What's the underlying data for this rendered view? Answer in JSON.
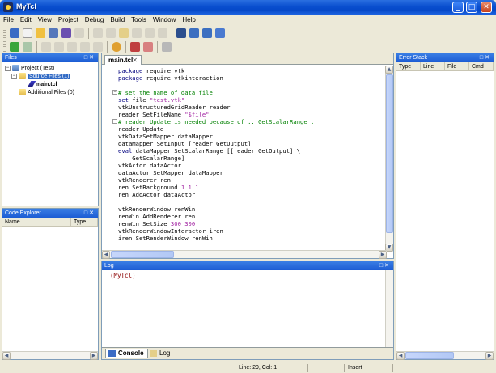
{
  "window": {
    "title": "MyTcl"
  },
  "menu": [
    "File",
    "Edit",
    "View",
    "Project",
    "Debug",
    "Build",
    "Tools",
    "Window",
    "Help"
  ],
  "files_panel": {
    "title": "Files",
    "project": "Project (Test)",
    "source_files": "Source Files (1)",
    "main_file": "main.tcl",
    "additional_files": "Additional Files (0)"
  },
  "code_explorer": {
    "title": "Code Explorer",
    "columns": [
      "Name",
      "Type"
    ]
  },
  "editor": {
    "tab_label": "main.tcl",
    "lines": [
      "package require vtk",
      "package require vtkinteraction",
      "",
      "# set the name of data file",
      "set file \"test.vtk\"",
      "vtkUnstructuredGridReader reader",
      "reader SetFileName \"$file\"",
      "# reader Update is needed because of .. GetScalarRange ..",
      "reader Update",
      "vtkDataSetMapper dataMapper",
      "dataMapper SetInput [reader GetOutput]",
      "eval dataMapper SetScalarRange [[reader GetOutput] \\",
      "    GetScalarRange]",
      "vtkActor dataActor",
      "dataActor SetMapper dataMapper",
      "vtkRenderer ren",
      "ren SetBackground 1 1 1",
      "ren AddActor dataActor",
      "",
      "vtkRenderWindow renWin",
      "renWin AddRenderer ren",
      "renWin SetSize 300 300",
      "vtkRenderWindowInteractor iren",
      "iren SetRenderWindow renWin"
    ]
  },
  "error_stack": {
    "title": "Error Stack",
    "columns": [
      "Type",
      "Line",
      "File",
      "Cmd"
    ]
  },
  "log": {
    "title": "Log",
    "text": "(MyTcl)",
    "tabs": [
      "Console",
      "Log"
    ]
  },
  "status": {
    "position": "Line: 29, Col: 1",
    "mode": "Insert"
  },
  "colors": {
    "title_bar": "#0548c8",
    "panel_header": "#2a6ae0",
    "comment": "#008000",
    "string": "#a020a0",
    "log_text": "#8b0000"
  }
}
